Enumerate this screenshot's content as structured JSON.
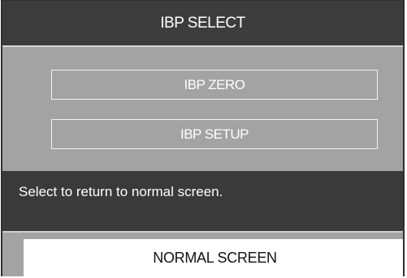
{
  "dialog": {
    "title": "IBP SELECT"
  },
  "menu": {
    "items": [
      {
        "label": "IBP ZERO"
      },
      {
        "label": "IBP SETUP"
      }
    ]
  },
  "help": {
    "text": "Select to return to normal screen."
  },
  "footer": {
    "normal_screen_label": "NORMAL SCREEN"
  },
  "colors": {
    "title_bar": "#3c3c3c",
    "panel": "#a3a3a3",
    "help_panel": "#3a3a3a",
    "selected_button": "#ffffff"
  }
}
